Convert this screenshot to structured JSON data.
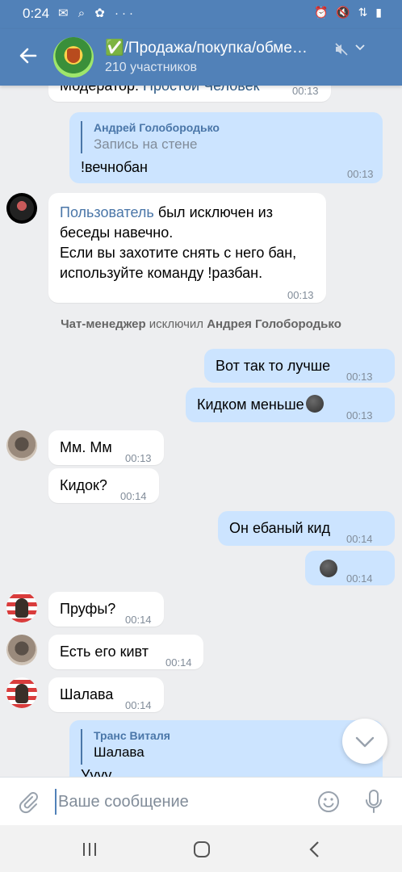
{
  "status_bar": {
    "time": "0:24",
    "left_icons": "✉ ⌕ ✿ ···",
    "right_icons": "⏰ 🔇 ⇅ ▮"
  },
  "header": {
    "title": "✅/Продажа/покупка/обме…",
    "subtitle": "210 участников",
    "icons": [
      "back-arrow-icon",
      "muted-icon",
      "chevron-down-icon"
    ]
  },
  "chat": {
    "partial_top": {
      "label": "Модератор:",
      "link": "Простой Человек",
      "time": "00:13"
    },
    "reply_msg": {
      "reply_name": "Андрей Голобородько",
      "reply_text": "Запись на стене",
      "text": "!вечнобан",
      "time": "00:13"
    },
    "bot_msg": {
      "link": "Пользователь",
      "line1": " был исключен из",
      "line2": "беседы навечно.",
      "line3": "Если вы захотите снять с него бан,",
      "line4": "используйте команду !разбан.",
      "time": "00:13"
    },
    "system_msg": {
      "actor": "Чат-менеджер",
      "action": " исключил ",
      "target": "Андрея Голобородько"
    },
    "messages": [
      {
        "text": "Вот так то лучше",
        "time": "00:13"
      },
      {
        "text": "Кидком меньше",
        "time": "00:13"
      },
      {
        "text": "Мм. Мм",
        "time": "00:13"
      },
      {
        "text": "Кидок?",
        "time": "00:14"
      },
      {
        "text": "Он ебаный кид",
        "time": "00:14"
      },
      {
        "text": "",
        "time": "00:14"
      },
      {
        "text": "Пруфы?",
        "time": "00:14"
      },
      {
        "text": "Есть его кивт",
        "time": "00:14"
      },
      {
        "text": "Шалава",
        "time": "00:14"
      }
    ],
    "bottom_reply": {
      "reply_name": "Транс Виталя",
      "reply_text": "Шалава",
      "text": "Уууу"
    }
  },
  "composer": {
    "placeholder": "Ваше сообщение"
  },
  "colors": {
    "header": "#5181b8",
    "outgoing": "#cce4ff",
    "incoming": "#ffffff",
    "background": "#edeef0",
    "link": "#2a5885"
  }
}
